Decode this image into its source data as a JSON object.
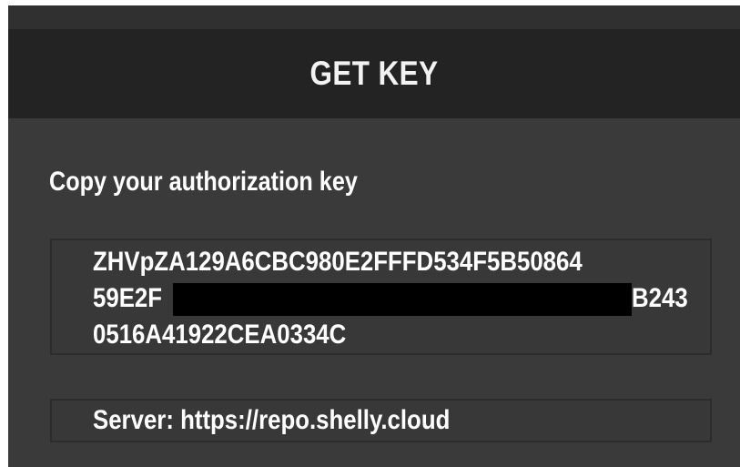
{
  "header": {
    "title": "GET KEY"
  },
  "instruction": "Copy your authorization key",
  "key": {
    "line1": "ZHVpZA129A6CBC980E2FFFD534F5B50864",
    "line2_start": "59E2F",
    "line2_end": "B243",
    "line3": "0516A41922CEA0334C"
  },
  "server": {
    "text": "Server: https://repo.shelly.cloud"
  },
  "colors": {
    "header_bg": "#232323",
    "panel_bg": "#3a3a3a",
    "text": "#ffffff",
    "redaction": "#000000"
  }
}
